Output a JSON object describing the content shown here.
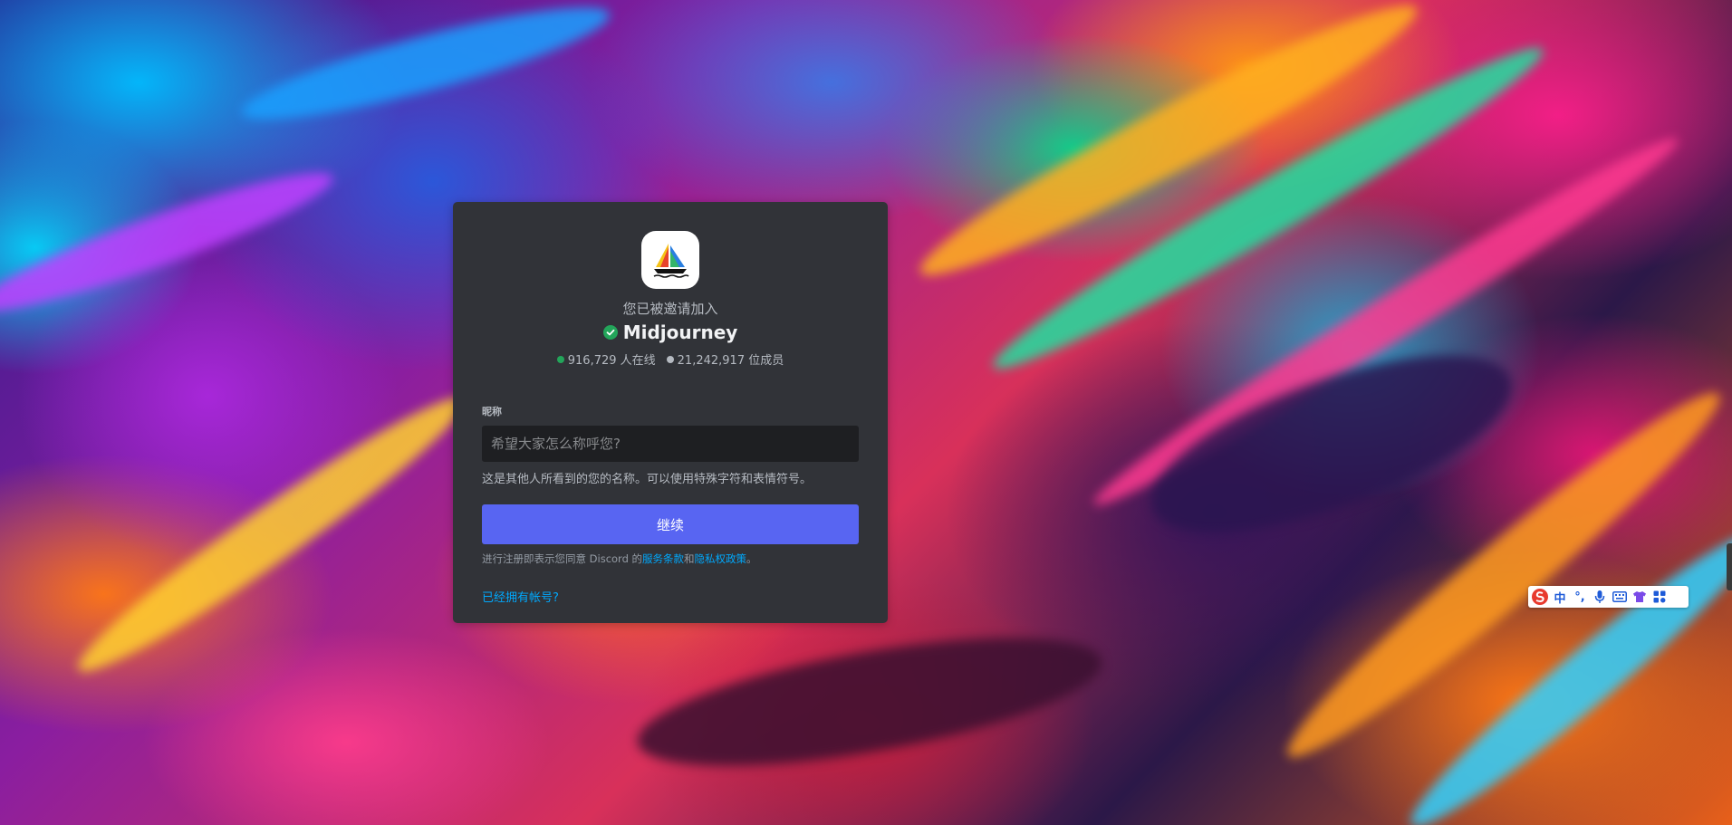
{
  "invite": {
    "intro": "您已被邀请加入",
    "server_name": "Midjourney",
    "online": "916,729 人在线",
    "members": "21,242,917 位成员"
  },
  "form": {
    "nickname_label": "昵称",
    "nickname_placeholder": "希望大家怎么称呼您?",
    "nickname_value": "",
    "hint": "这是其他人所看到的您的名称。可以使用特殊字符和表情符号。",
    "continue_label": "继续",
    "terms_prefix": "进行注册即表示您同意 Discord 的",
    "terms_link": "服务条款",
    "terms_and": "和",
    "privacy_link": "隐私权政策",
    "terms_suffix": "。",
    "login_link": "已经拥有帐号?"
  },
  "ime": {
    "mode": "中",
    "punct": "°,"
  },
  "colors": {
    "card_bg": "#313338",
    "accent": "#5865f2",
    "link": "#00a8fc",
    "online_dot": "#23a55a",
    "member_dot": "#b5bac1"
  }
}
